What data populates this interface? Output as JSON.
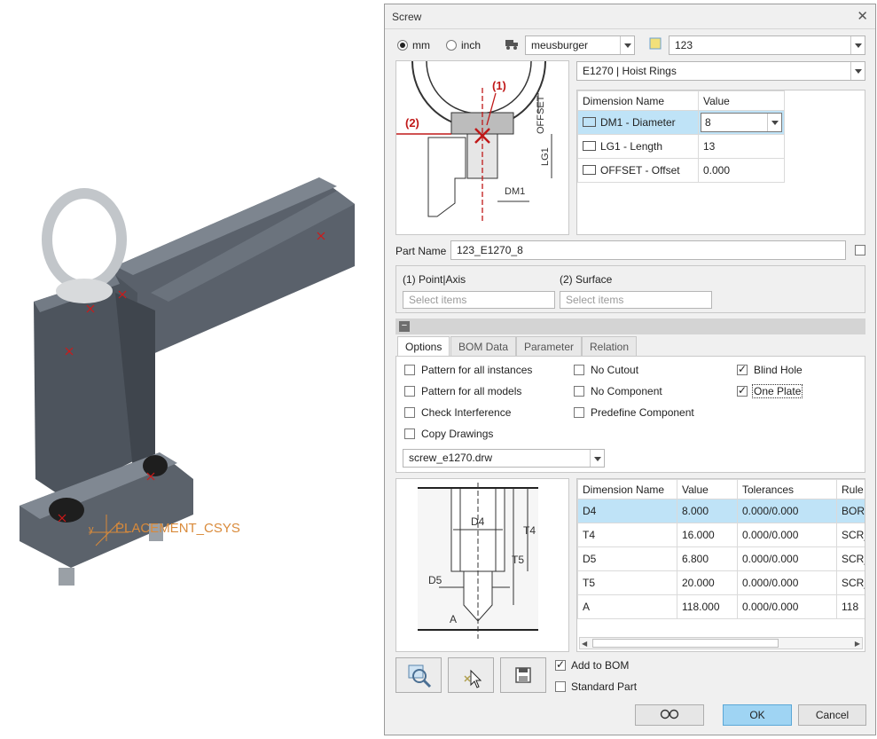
{
  "viewport": {
    "csys_label": "PLACEMENT_CSYS",
    "axis_y": "y",
    "axis_x": "x"
  },
  "dialog": {
    "title": "Screw",
    "units": {
      "mm": "mm",
      "inch": "inch",
      "selected": "mm"
    },
    "supplier": "meusburger",
    "catalog": "123",
    "product": "E1270 | Hoist Rings",
    "schematic_labels": {
      "p1": "(1)",
      "p2": "(2)",
      "offset": "OFFSET",
      "lg1": "LG1",
      "dm1": "DM1"
    },
    "dimensions": {
      "headers": [
        "Dimension Name",
        "Value"
      ],
      "rows": [
        {
          "name": "DM1 - Diameter",
          "value": "8"
        },
        {
          "name": "LG1 - Length",
          "value": "13"
        },
        {
          "name": "OFFSET - Offset",
          "value": "0.000"
        }
      ]
    },
    "part_name": {
      "label": "Part Name",
      "value": "123_E1270_8"
    },
    "references": {
      "point_label": "(1) Point|Axis",
      "surface_label": "(2) Surface",
      "point_placeholder": "Select items",
      "surface_placeholder": "Select items"
    },
    "tabs": [
      "Options",
      "BOM Data",
      "Parameter",
      "Relation"
    ],
    "options": [
      {
        "label": "Pattern for all instances",
        "checked": false
      },
      {
        "label": "Pattern for all models",
        "checked": false
      },
      {
        "label": "Check Interference",
        "checked": false
      },
      {
        "label": "Copy Drawings",
        "checked": false
      },
      {
        "label": "No Cutout",
        "checked": false
      },
      {
        "label": "No Component",
        "checked": false
      },
      {
        "label": "Predefine Component",
        "checked": false
      },
      {
        "label": "Blind Hole",
        "checked": true
      },
      {
        "label": "One Plate",
        "checked": true
      }
    ],
    "drawing": "screw_e1270.drw",
    "hole_labels": {
      "d4": "D4",
      "t4": "T4",
      "t5": "T5",
      "d5": "D5",
      "a": "A"
    },
    "hole_table": {
      "headers": [
        "Dimension Name",
        "Value",
        "Tolerances",
        "Rule"
      ],
      "rows": [
        {
          "name": "D4",
          "value": "8.000",
          "tol": "0.000/0.000",
          "rule": "BORE_"
        },
        {
          "name": "T4",
          "value": "16.000",
          "tol": "0.000/0.000",
          "rule": "SCR_T"
        },
        {
          "name": "D5",
          "value": "6.800",
          "tol": "0.000/0.000",
          "rule": "SCR_C"
        },
        {
          "name": "T5",
          "value": "20.000",
          "tol": "0.000/0.000",
          "rule": "SCR_C"
        },
        {
          "name": "A",
          "value": "118.000",
          "tol": "0.000/0.000",
          "rule": "118"
        }
      ]
    },
    "bom": {
      "add_to_bom": "Add to BOM",
      "add_checked": true,
      "standard_part": "Standard Part",
      "standard_checked": false
    },
    "buttons": {
      "ok": "OK",
      "cancel": "Cancel"
    },
    "icons": [
      "preview-icon",
      "placement-icon",
      "save-icon",
      "glasses-icon"
    ]
  }
}
